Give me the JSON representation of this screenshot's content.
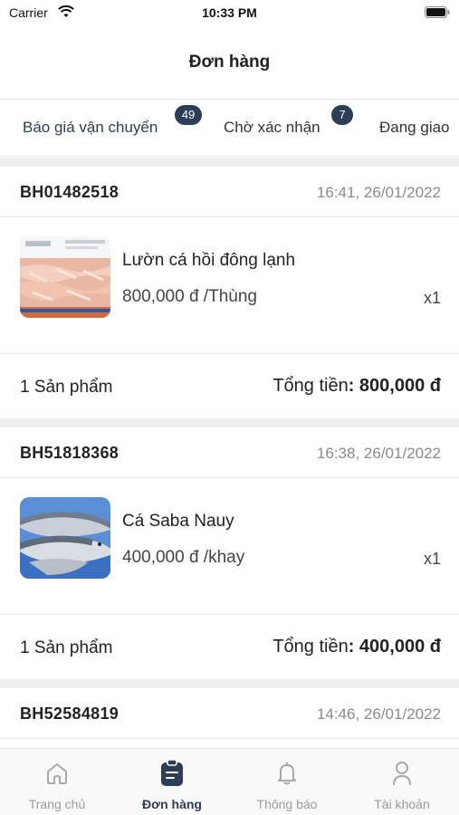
{
  "status_bar": {
    "carrier": "Carrier",
    "time": "10:33 PM",
    "wifi_icon": "wifi-icon",
    "battery_icon": "battery-icon"
  },
  "header": {
    "title": "Đơn hàng"
  },
  "tabs": [
    {
      "label": "Báo giá vận chuyển",
      "badge": "49",
      "active": true
    },
    {
      "label": "Chờ xác nhận",
      "badge": "7",
      "active": false
    },
    {
      "label": "Đang giao",
      "badge": "",
      "active": false
    }
  ],
  "orders": [
    {
      "code": "BH01482518",
      "time": "16:41, 26/01/2022",
      "item": {
        "name": "Lườn cá hồi đông lạnh",
        "price": "800,000 đ /Thùng",
        "qty": "x1",
        "image": "frozen-salmon-belly-box"
      },
      "product_count": "1 Sản phẩm",
      "total_label": "Tổng tiền",
      "total_colon": ": ",
      "total_amount": "800,000 đ"
    },
    {
      "code": "BH51818368",
      "time": "16:38, 26/01/2022",
      "item": {
        "name": "Cá Saba Nauy",
        "price": "400,000 đ /khay",
        "qty": "x1",
        "image": "norwegian-mackerel-tray"
      },
      "product_count": "1 Sản phẩm",
      "total_label": "Tổng tiền",
      "total_colon": ": ",
      "total_amount": "400,000 đ"
    },
    {
      "code": "BH52584819",
      "time": "14:46, 26/01/2022"
    }
  ],
  "tab_bar": [
    {
      "label": "Trang chủ",
      "icon": "home-icon",
      "active": false
    },
    {
      "label": "Đơn hàng",
      "icon": "clipboard-icon",
      "active": true
    },
    {
      "label": "Thông báo",
      "icon": "bell-icon",
      "active": false
    },
    {
      "label": "Tài khoản",
      "icon": "user-icon",
      "active": false
    }
  ],
  "colors": {
    "accent": "#2c3e56",
    "muted": "#9a9a9a",
    "separator": "#efefef"
  }
}
